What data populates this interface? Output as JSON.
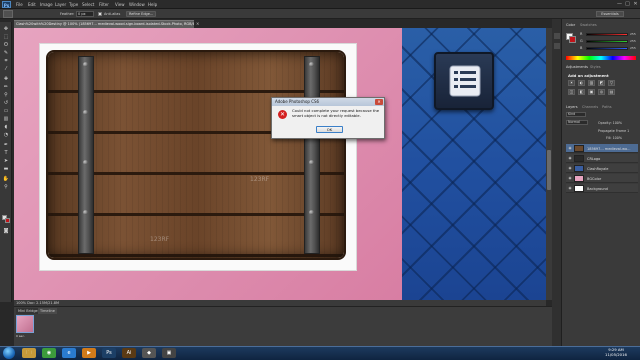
{
  "app": {
    "logo": "Ps"
  },
  "menu": [
    "File",
    "Edit",
    "Image",
    "Layer",
    "Type",
    "Select",
    "Filter",
    "View",
    "Window",
    "Help"
  ],
  "window_controls": [
    "—",
    "□",
    "✕"
  ],
  "options": {
    "feather_label": "Feather:",
    "feather_value": "0 px",
    "antialias_label": "Anti-alias",
    "refine_button": "Refine Edge...",
    "workspace": "Essentials"
  },
  "document": {
    "tab_title": "Clash%20with%20Destiny @ 100% (185697... medieval-wood-sign-board-isolated-Stock-Photo, RGB/8#) *",
    "watermark": "123RF",
    "status": "100%   Doc: 2.15M/21.8M"
  },
  "dialog": {
    "title": "Adobe Photoshop CS6",
    "close": "✕",
    "message": "Could not complete your request because the smart object is not directly editable.",
    "ok_label": "OK",
    "icon": "error-icon"
  },
  "bottom_panel": {
    "tabs": [
      "Mini Bridge",
      "Timeline"
    ],
    "frame_label": "0 sec."
  },
  "right_panel": {
    "color_tabs": [
      "Color",
      "Swatches"
    ],
    "sliders": [
      {
        "label": "R",
        "value": "255",
        "color": "#ff3030"
      },
      {
        "label": "G",
        "value": "255",
        "color": "#30d030"
      },
      {
        "label": "B",
        "value": "255",
        "color": "#3060ff"
      }
    ],
    "adjust_tabs": [
      "Adjustments",
      "Styles"
    ],
    "adjust_title": "Add an adjustment",
    "adjust_icons": [
      "☀",
      "◐",
      "▥",
      "◩",
      "▽",
      "◫",
      "◧",
      "▣",
      "◎",
      "▤"
    ],
    "layer_tabs": [
      "Layers",
      "Channels",
      "Paths"
    ],
    "layer_kind": "Kind",
    "blend_mode": "Normal",
    "opacity": "Opacity: 100%",
    "propagate": "Propagate Frame 1",
    "fill": "Fill: 100%",
    "layers": [
      {
        "name": "185697... medieval-wo...",
        "color": "#6b4a2e",
        "selected": true
      },
      {
        "name": "CRLogo",
        "color": "#2a2a2a",
        "selected": false
      },
      {
        "name": "ClashRoyale",
        "color": "#3a5ea0",
        "selected": false
      },
      {
        "name": "BGColor",
        "color": "#e7a4c0",
        "selected": false
      },
      {
        "name": "Background",
        "color": "#ffffff",
        "selected": false
      }
    ]
  },
  "taskbar": {
    "apps": [
      {
        "name": "explorer",
        "glyph": "🗀",
        "color": "#c59a3a"
      },
      {
        "name": "chrome",
        "glyph": "◉",
        "color": "#3c9b3c"
      },
      {
        "name": "ie",
        "glyph": "e",
        "color": "#2a7bd0"
      },
      {
        "name": "media",
        "glyph": "▶",
        "color": "#d07a1a"
      },
      {
        "name": "photoshop",
        "glyph": "Ps",
        "color": "#1c3f66"
      },
      {
        "name": "illustrator",
        "glyph": "Ai",
        "color": "#5a3a14"
      },
      {
        "name": "app",
        "glyph": "◆",
        "color": "#555555"
      },
      {
        "name": "app2",
        "glyph": "▣",
        "color": "#444444"
      }
    ],
    "time": "9:29 AM",
    "date": "11/05/2016"
  },
  "colors": {
    "accent": "#2150a0",
    "canvas_pink": "#de8fb0",
    "error": "#d42020"
  }
}
